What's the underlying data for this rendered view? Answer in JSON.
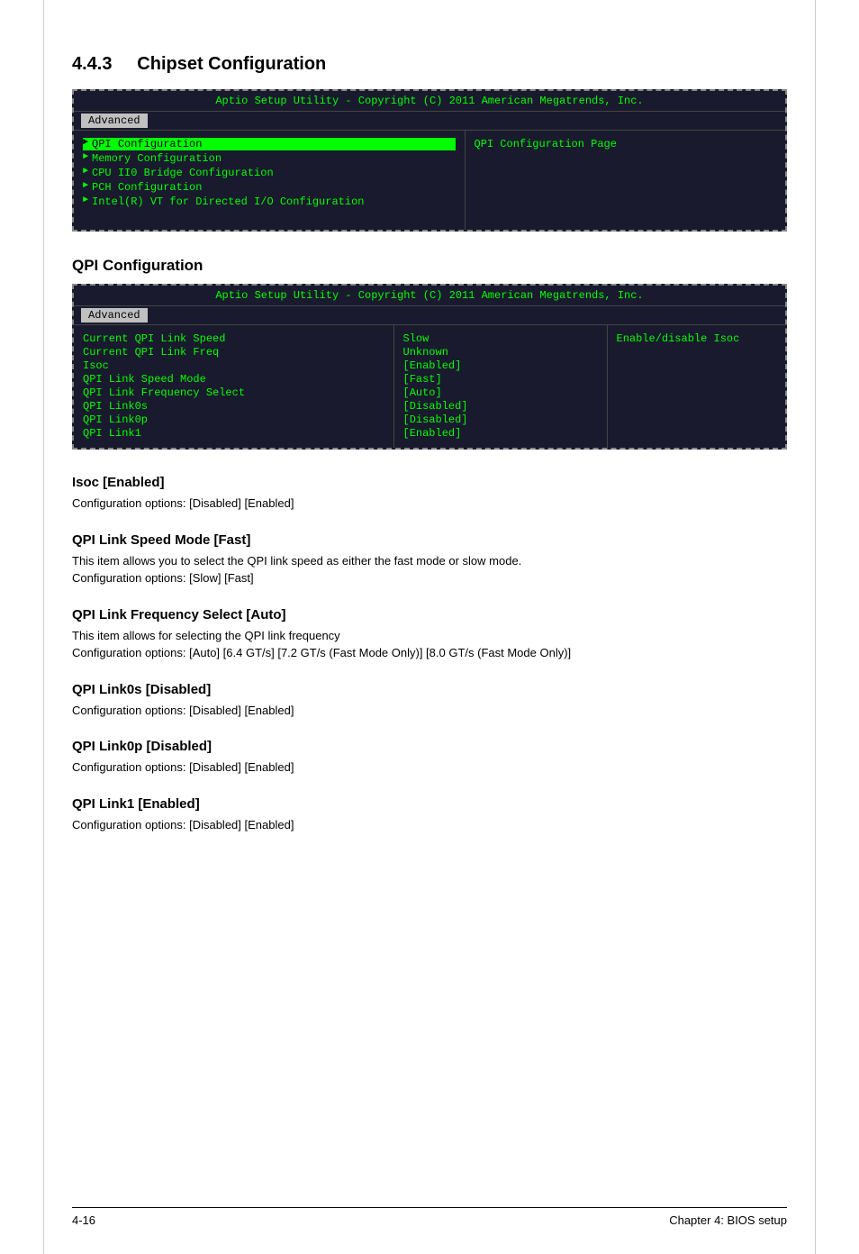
{
  "section": {
    "number": "4.4.3",
    "title": "Chipset Configuration"
  },
  "chipset_bios": {
    "header": "Aptio Setup Utility - Copyright (C) 2011 American Megatrends, Inc.",
    "tab": "Advanced",
    "menu_items": [
      {
        "label": "QPI Configuration",
        "selected": true
      },
      {
        "label": "Memory Configuration",
        "selected": false
      },
      {
        "label": "CPU II0 Bridge Configuration",
        "selected": false
      },
      {
        "label": "PCH Configuration",
        "selected": false
      },
      {
        "label": "Intel(R) VT for Directed I/O Configuration",
        "selected": false
      }
    ],
    "right_label": "QPI Configuration Page"
  },
  "qpi_section": {
    "title": "QPI Configuration",
    "bios": {
      "header": "Aptio Setup Utility - Copyright (C) 2011 American Megatrends, Inc.",
      "tab": "Advanced",
      "rows_left": [
        "Current QPI Link Speed",
        "Current QPI Link Freq",
        "Isoc",
        "QPI Link Speed Mode",
        "QPI Link Frequency Select",
        "QPI Link0s",
        "QPI Link0p",
        "QPI Link1"
      ],
      "rows_mid": [
        "Slow",
        "Unknown",
        "[Enabled]",
        "[Fast]",
        "[Auto]",
        "[Disabled]",
        "[Disabled]",
        "[Enabled]"
      ],
      "right_label": "Enable/disable Isoc"
    }
  },
  "descriptions": [
    {
      "id": "isoc",
      "title": "Isoc [Enabled]",
      "body": "Configuration options: [Disabled] [Enabled]"
    },
    {
      "id": "qpi-link-speed",
      "title": "QPI Link Speed Mode [Fast]",
      "body": "This item allows you to select the QPI link speed as either the fast mode or slow mode.\nConfiguration options: [Slow] [Fast]"
    },
    {
      "id": "qpi-freq",
      "title": "QPI Link Frequency Select [Auto]",
      "body": "This item allows for selecting the QPI link frequency\nConfiguration options: [Auto] [6.4 GT/s] [7.2 GT/s (Fast Mode Only)] [8.0 GT/s (Fast Mode Only)]"
    },
    {
      "id": "qpi-link0s",
      "title": "QPI Link0s [Disabled]",
      "body": "Configuration options: [Disabled] [Enabled]"
    },
    {
      "id": "qpi-link0p",
      "title": "QPI Link0p [Disabled]",
      "body": "Configuration options: [Disabled] [Enabled]"
    },
    {
      "id": "qpi-link1",
      "title": "QPI Link1 [Enabled]",
      "body": "Configuration options: [Disabled] [Enabled]"
    }
  ],
  "footer": {
    "left": "4-16",
    "right": "Chapter 4: BIOS setup"
  }
}
